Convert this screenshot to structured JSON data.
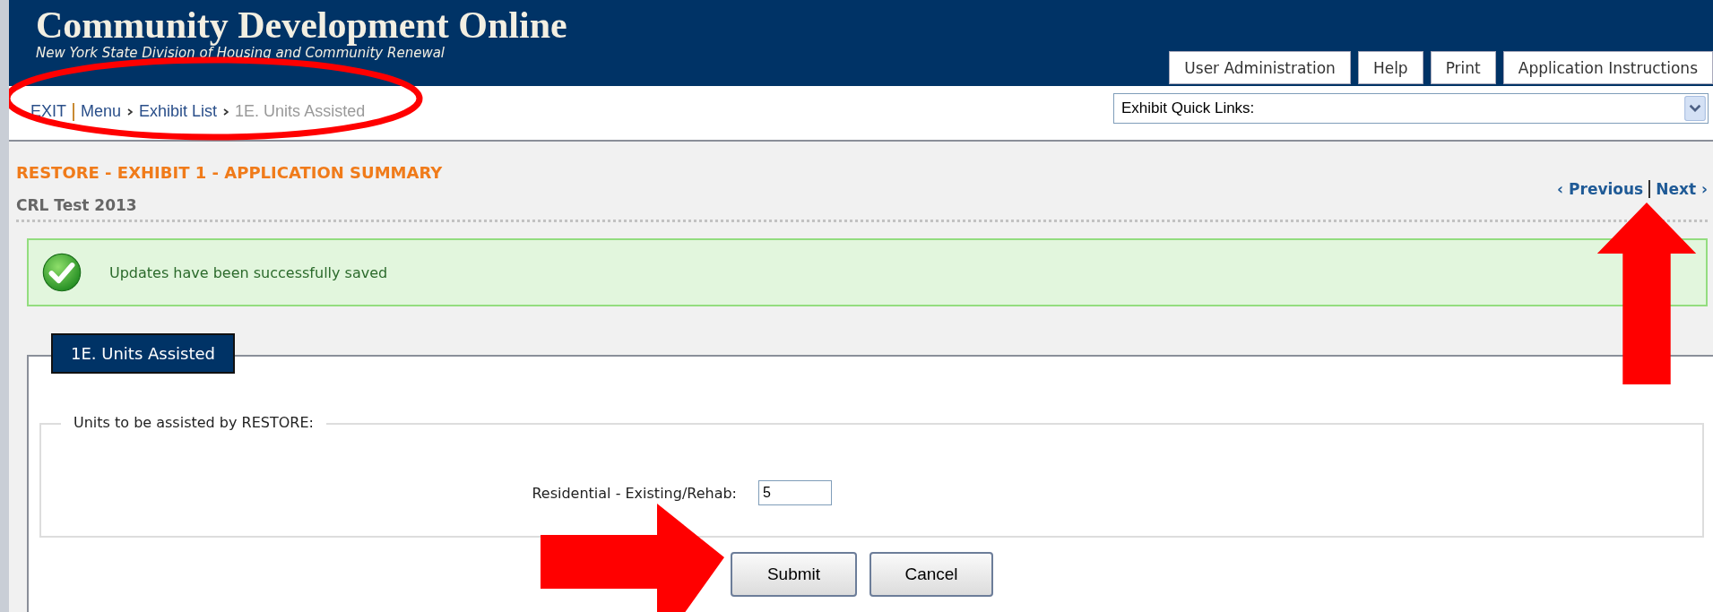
{
  "header": {
    "title": "Community Development Online",
    "subtitle": "New York State Division of Housing and Community Renewal",
    "buttons": [
      "User Administration",
      "Help",
      "Print",
      "Application Instructions"
    ]
  },
  "breadcrumb": {
    "links": [
      "EXIT",
      "Menu",
      "Exhibit List"
    ],
    "current": "1E. Units Assisted"
  },
  "quick_links": {
    "value": "Exhibit Quick Links:"
  },
  "page": {
    "title": "RESTORE - EXHIBIT 1 - APPLICATION SUMMARY",
    "subtitle": "CRL Test 2013",
    "previous": "‹ Previous",
    "next": "Next ›"
  },
  "message": {
    "text": "Updates have been successfully saved"
  },
  "section": {
    "legend": "1E. Units Assisted",
    "group_title": "Units to be assisted by RESTORE:",
    "fields": [
      {
        "label": "Residential - Existing/Rehab:",
        "value": "5"
      }
    ]
  },
  "buttons": [
    "Submit",
    "Cancel"
  ],
  "annotations": [
    {
      "kind": "ellipse"
    },
    {
      "kind": "arrow-up"
    },
    {
      "kind": "arrow-right"
    }
  ]
}
